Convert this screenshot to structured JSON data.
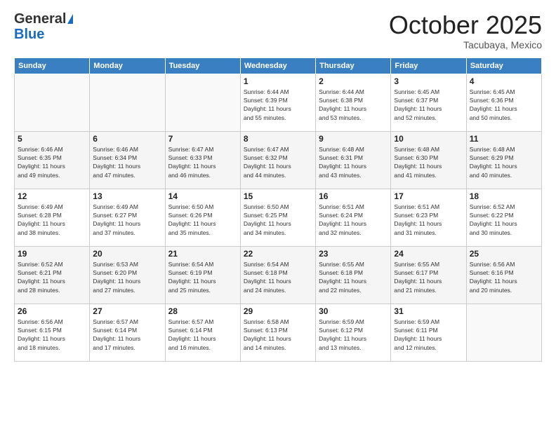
{
  "header": {
    "logo_general": "General",
    "logo_blue": "Blue",
    "month": "October 2025",
    "location": "Tacubaya, Mexico"
  },
  "days_of_week": [
    "Sunday",
    "Monday",
    "Tuesday",
    "Wednesday",
    "Thursday",
    "Friday",
    "Saturday"
  ],
  "weeks": [
    [
      {
        "day": "",
        "info": ""
      },
      {
        "day": "",
        "info": ""
      },
      {
        "day": "",
        "info": ""
      },
      {
        "day": "1",
        "info": "Sunrise: 6:44 AM\nSunset: 6:39 PM\nDaylight: 11 hours\nand 55 minutes."
      },
      {
        "day": "2",
        "info": "Sunrise: 6:44 AM\nSunset: 6:38 PM\nDaylight: 11 hours\nand 53 minutes."
      },
      {
        "day": "3",
        "info": "Sunrise: 6:45 AM\nSunset: 6:37 PM\nDaylight: 11 hours\nand 52 minutes."
      },
      {
        "day": "4",
        "info": "Sunrise: 6:45 AM\nSunset: 6:36 PM\nDaylight: 11 hours\nand 50 minutes."
      }
    ],
    [
      {
        "day": "5",
        "info": "Sunrise: 6:46 AM\nSunset: 6:35 PM\nDaylight: 11 hours\nand 49 minutes."
      },
      {
        "day": "6",
        "info": "Sunrise: 6:46 AM\nSunset: 6:34 PM\nDaylight: 11 hours\nand 47 minutes."
      },
      {
        "day": "7",
        "info": "Sunrise: 6:47 AM\nSunset: 6:33 PM\nDaylight: 11 hours\nand 46 minutes."
      },
      {
        "day": "8",
        "info": "Sunrise: 6:47 AM\nSunset: 6:32 PM\nDaylight: 11 hours\nand 44 minutes."
      },
      {
        "day": "9",
        "info": "Sunrise: 6:48 AM\nSunset: 6:31 PM\nDaylight: 11 hours\nand 43 minutes."
      },
      {
        "day": "10",
        "info": "Sunrise: 6:48 AM\nSunset: 6:30 PM\nDaylight: 11 hours\nand 41 minutes."
      },
      {
        "day": "11",
        "info": "Sunrise: 6:48 AM\nSunset: 6:29 PM\nDaylight: 11 hours\nand 40 minutes."
      }
    ],
    [
      {
        "day": "12",
        "info": "Sunrise: 6:49 AM\nSunset: 6:28 PM\nDaylight: 11 hours\nand 38 minutes."
      },
      {
        "day": "13",
        "info": "Sunrise: 6:49 AM\nSunset: 6:27 PM\nDaylight: 11 hours\nand 37 minutes."
      },
      {
        "day": "14",
        "info": "Sunrise: 6:50 AM\nSunset: 6:26 PM\nDaylight: 11 hours\nand 35 minutes."
      },
      {
        "day": "15",
        "info": "Sunrise: 6:50 AM\nSunset: 6:25 PM\nDaylight: 11 hours\nand 34 minutes."
      },
      {
        "day": "16",
        "info": "Sunrise: 6:51 AM\nSunset: 6:24 PM\nDaylight: 11 hours\nand 32 minutes."
      },
      {
        "day": "17",
        "info": "Sunrise: 6:51 AM\nSunset: 6:23 PM\nDaylight: 11 hours\nand 31 minutes."
      },
      {
        "day": "18",
        "info": "Sunrise: 6:52 AM\nSunset: 6:22 PM\nDaylight: 11 hours\nand 30 minutes."
      }
    ],
    [
      {
        "day": "19",
        "info": "Sunrise: 6:52 AM\nSunset: 6:21 PM\nDaylight: 11 hours\nand 28 minutes."
      },
      {
        "day": "20",
        "info": "Sunrise: 6:53 AM\nSunset: 6:20 PM\nDaylight: 11 hours\nand 27 minutes."
      },
      {
        "day": "21",
        "info": "Sunrise: 6:54 AM\nSunset: 6:19 PM\nDaylight: 11 hours\nand 25 minutes."
      },
      {
        "day": "22",
        "info": "Sunrise: 6:54 AM\nSunset: 6:18 PM\nDaylight: 11 hours\nand 24 minutes."
      },
      {
        "day": "23",
        "info": "Sunrise: 6:55 AM\nSunset: 6:18 PM\nDaylight: 11 hours\nand 22 minutes."
      },
      {
        "day": "24",
        "info": "Sunrise: 6:55 AM\nSunset: 6:17 PM\nDaylight: 11 hours\nand 21 minutes."
      },
      {
        "day": "25",
        "info": "Sunrise: 6:56 AM\nSunset: 6:16 PM\nDaylight: 11 hours\nand 20 minutes."
      }
    ],
    [
      {
        "day": "26",
        "info": "Sunrise: 6:56 AM\nSunset: 6:15 PM\nDaylight: 11 hours\nand 18 minutes."
      },
      {
        "day": "27",
        "info": "Sunrise: 6:57 AM\nSunset: 6:14 PM\nDaylight: 11 hours\nand 17 minutes."
      },
      {
        "day": "28",
        "info": "Sunrise: 6:57 AM\nSunset: 6:14 PM\nDaylight: 11 hours\nand 16 minutes."
      },
      {
        "day": "29",
        "info": "Sunrise: 6:58 AM\nSunset: 6:13 PM\nDaylight: 11 hours\nand 14 minutes."
      },
      {
        "day": "30",
        "info": "Sunrise: 6:59 AM\nSunset: 6:12 PM\nDaylight: 11 hours\nand 13 minutes."
      },
      {
        "day": "31",
        "info": "Sunrise: 6:59 AM\nSunset: 6:11 PM\nDaylight: 11 hours\nand 12 minutes."
      },
      {
        "day": "",
        "info": ""
      }
    ]
  ]
}
